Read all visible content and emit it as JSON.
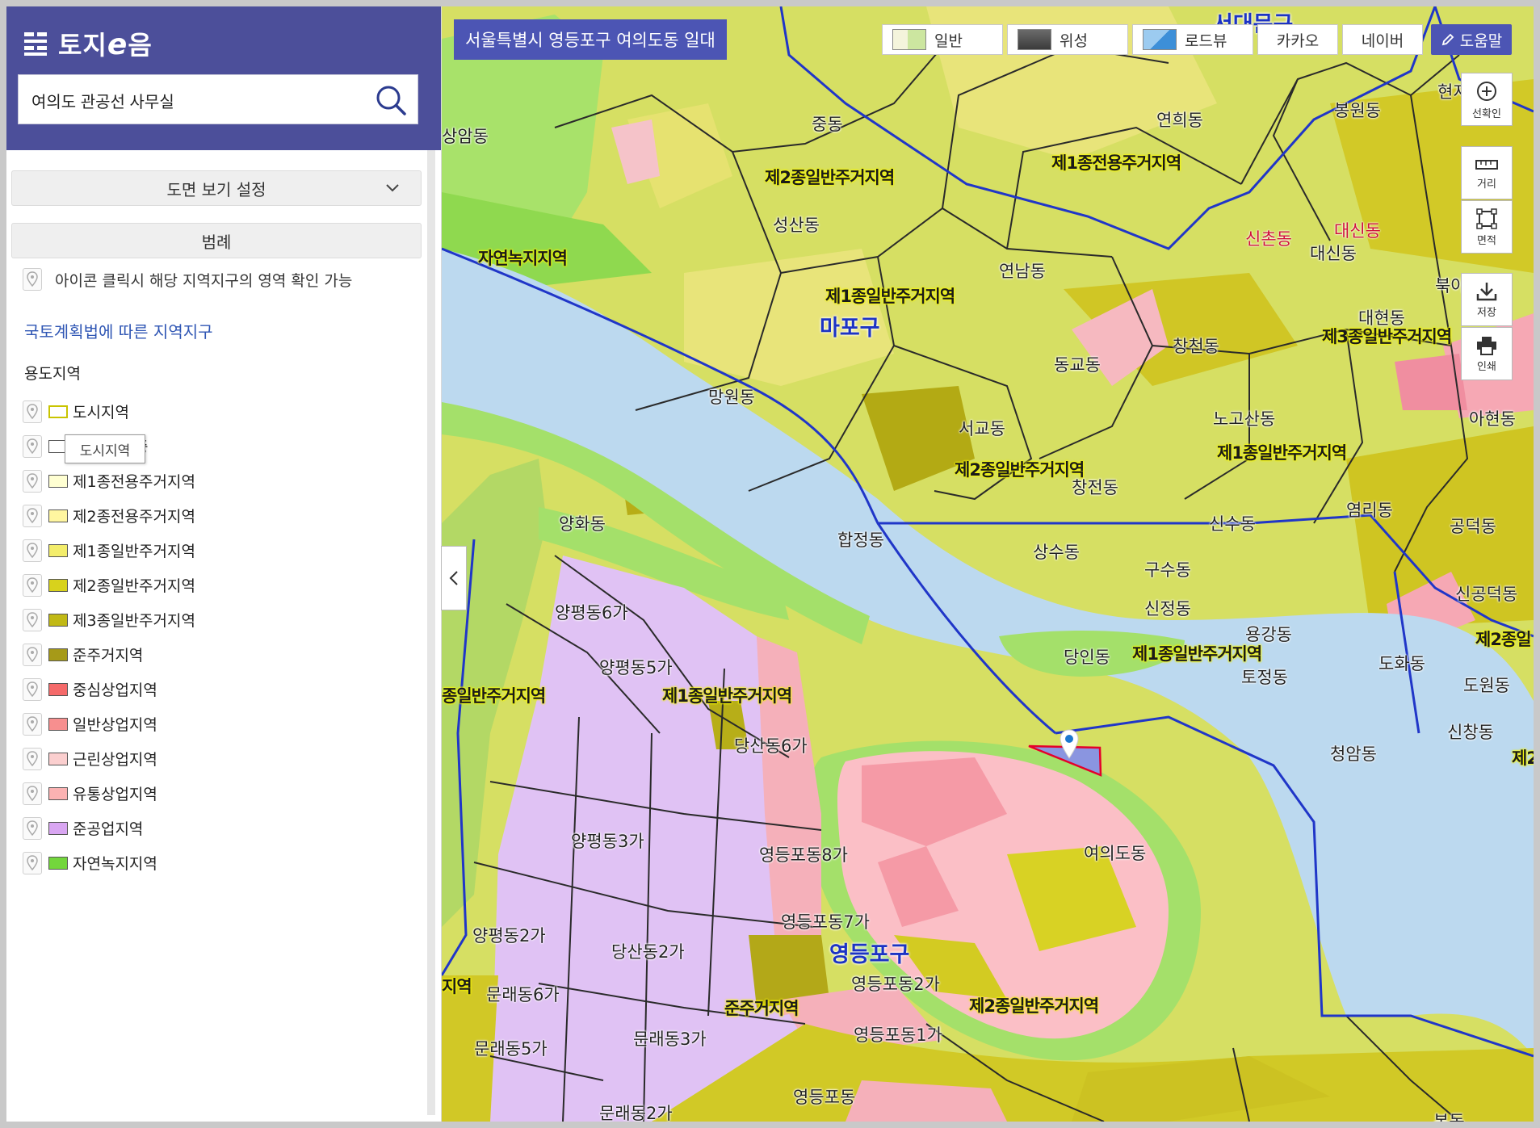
{
  "app": {
    "logo_text": "토지",
    "logo_e": "e",
    "logo_rest": "음"
  },
  "search": {
    "value": "여의도 관공선 사무실"
  },
  "panel": {
    "view_settings_label": "도면 보기 설정",
    "legend_title": "범례",
    "hint_text": "아이콘 클릭시 해당 지역지구의 영역 확인 가능",
    "section_link": "국토계획법에 따른 지역지구",
    "zone_group_label": "용도지역",
    "tooltip_text": "도시지역",
    "legend_items": [
      {
        "label": "도시지역",
        "color": "#ffffff",
        "border": "#c9c400"
      },
      {
        "label": "계획 입안중",
        "color": "#ffffff",
        "border": "#555555"
      },
      {
        "label": "제1종전용주거지역",
        "color": "#ffffd2",
        "border": "#555555"
      },
      {
        "label": "제2종전용주거지역",
        "color": "#fff6a0",
        "border": "#555555"
      },
      {
        "label": "제1종일반주거지역",
        "color": "#f3ed6b",
        "border": "#555555"
      },
      {
        "label": "제2종일반주거지역",
        "color": "#d8d21c",
        "border": "#555555"
      },
      {
        "label": "제3종일반주거지역",
        "color": "#c1b915",
        "border": "#555555"
      },
      {
        "label": "준주거지역",
        "color": "#a69a18",
        "border": "#555555"
      },
      {
        "label": "중심상업지역",
        "color": "#f56a6a",
        "border": "#555555"
      },
      {
        "label": "일반상업지역",
        "color": "#f78f8f",
        "border": "#555555"
      },
      {
        "label": "근린상업지역",
        "color": "#fbcfcf",
        "border": "#555555"
      },
      {
        "label": "유통상업지역",
        "color": "#fbb2b2",
        "border": "#555555"
      },
      {
        "label": "준공업지역",
        "color": "#d9a6f2",
        "border": "#555555"
      },
      {
        "label": "자연녹지지역",
        "color": "#73d63c",
        "border": "#555555"
      }
    ]
  },
  "map": {
    "location_banner": "서울특별시 영등포구 여의도동 일대",
    "map_types": [
      "일반",
      "위성",
      "로드뷰",
      "카카오",
      "네이버"
    ],
    "help_label": "도움말",
    "tools": [
      "선확인",
      "거리",
      "면적",
      "저장",
      "인쇄"
    ],
    "gu_labels": [
      "마포구",
      "영등포구",
      "서대문구"
    ],
    "dong_labels": [
      "상암동",
      "중동",
      "연희동",
      "봉원동",
      "현저",
      "성산동",
      "연남동",
      "신촌동",
      "대신동",
      "대신동",
      "북아현동",
      "망원동",
      "동교동",
      "창천동",
      "대현동",
      "노고산동",
      "아현동",
      "서교동",
      "창전동",
      "염리동",
      "신수동",
      "양화동",
      "합정동",
      "상수동",
      "구수동",
      "공덕동",
      "신정동",
      "신공덕동",
      "용강동",
      "당인동",
      "토정동",
      "도화동",
      "도원동",
      "양평동6가",
      "양평동5가",
      "당산동6가",
      "청암동",
      "신창동",
      "양평동3가",
      "영등포동8가",
      "여의도동",
      "영등포동7가",
      "양평동2가",
      "당산동2가",
      "문래동6가",
      "영등포동2가",
      "문래동3가",
      "문래동5가",
      "영등포동1가",
      "문래동2가",
      "영등포동",
      "본동"
    ],
    "zone_labels": [
      "제2종일반주거지역",
      "제1종전용주거지역",
      "자연녹지지역",
      "제1종일반주거지역",
      "제3종일반주거지역",
      "제2종일반주거지역",
      "제1종일반주거지역",
      "제1종일반주거지역",
      "제1종일반주거지역",
      "종일반주거지역",
      "준주거지역",
      "제2종일반주거지역",
      "지역",
      "제2종일",
      "제2"
    ]
  }
}
